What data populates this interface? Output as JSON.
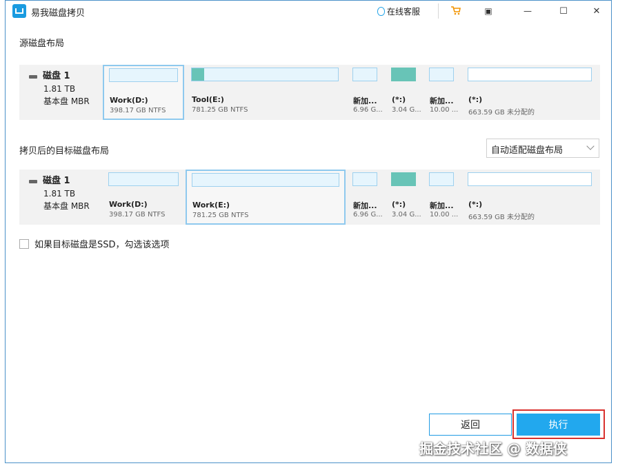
{
  "app": {
    "title": "易我磁盘拷贝"
  },
  "titlebar": {
    "service_label": "在线客服",
    "menu_glyph": "▣",
    "min_glyph": "—",
    "max_glyph": "☐",
    "close_glyph": "✕"
  },
  "source": {
    "label": "源磁盘布局",
    "disk": {
      "name": "磁盘 1",
      "size": "1.81 TB",
      "type": "基本盘 MBR"
    },
    "partitions": [
      {
        "name": "Work(D:)",
        "size": "398.17 GB NTFS",
        "used": 0
      },
      {
        "name": "Tool(E:)",
        "size": "781.25 GB NTFS",
        "used": 0.08
      },
      {
        "name": "新加...",
        "size": "6.96 G...",
        "used": 0
      },
      {
        "name": "(*:)",
        "size": "3.04 G...",
        "used": 1
      },
      {
        "name": "新加...",
        "size": "10.00 ...",
        "used": 0
      },
      {
        "name": "(*:)",
        "size": "663.59 GB 未分配的",
        "used": 0
      }
    ]
  },
  "target": {
    "label": "拷贝后的目标磁盘布局",
    "layout_select": "自动适配磁盘布局",
    "disk": {
      "name": "磁盘 1",
      "size": "1.81 TB",
      "type": "基本盘 MBR"
    },
    "partitions": [
      {
        "name": "Work(D:)",
        "size": "398.17 GB NTFS",
        "used": 0
      },
      {
        "name": "Work(E:)",
        "size": "781.25 GB NTFS",
        "used": 0
      },
      {
        "name": "新加...",
        "size": "6.96 G...",
        "used": 0
      },
      {
        "name": "(*:)",
        "size": "3.04 G...",
        "used": 1
      },
      {
        "name": "新加...",
        "size": "10.00 ...",
        "used": 0
      },
      {
        "name": "(*:)",
        "size": "663.59 GB 未分配的",
        "used": 0
      }
    ]
  },
  "ssd_option": {
    "label": "如果目标磁盘是SSD，勾选该选项",
    "checked": false
  },
  "buttons": {
    "back": "返回",
    "execute": "执行"
  },
  "watermark": "掘金技术社区 @ 数据侠",
  "colors": {
    "accent": "#22a8ee",
    "partition_fill": "#68c4b7",
    "highlight": "#d9302c"
  }
}
